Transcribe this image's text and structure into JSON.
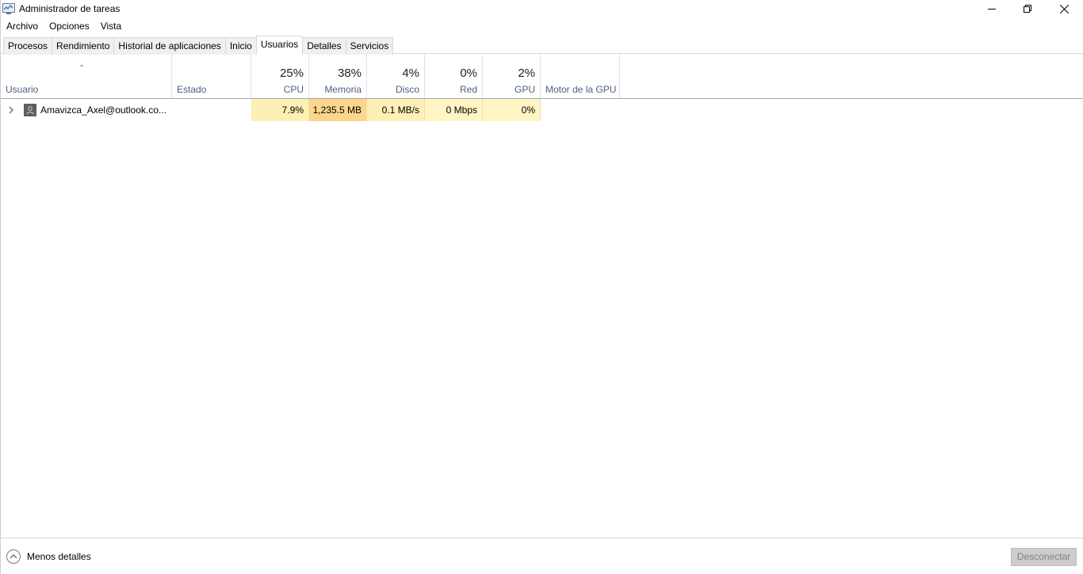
{
  "window": {
    "title": "Administrador de tareas",
    "icons": {
      "app": "task-manager-icon",
      "minimize": "minimize-icon",
      "restore": "restore-icon",
      "close": "close-icon"
    }
  },
  "menu": [
    "Archivo",
    "Opciones",
    "Vista"
  ],
  "tabs": [
    "Procesos",
    "Rendimiento",
    "Historial de aplicaciones",
    "Inicio",
    "Usuarios",
    "Detalles",
    "Servicios"
  ],
  "active_tab": "Usuarios",
  "columns": {
    "user": {
      "label": "Usuario",
      "sort": "ascending"
    },
    "state": {
      "label": "Estado"
    },
    "cpu": {
      "percent": "25%",
      "label": "CPU"
    },
    "memory": {
      "percent": "38%",
      "label": "Memoria"
    },
    "disk": {
      "percent": "4%",
      "label": "Disco"
    },
    "network": {
      "percent": "0%",
      "label": "Red"
    },
    "gpu": {
      "percent": "2%",
      "label": "GPU"
    },
    "gpu_engine": {
      "label": "Motor de la GPU"
    }
  },
  "rows": [
    {
      "user": "Amavizca_Axel@outlook.co...",
      "state": "",
      "cpu": "7.9%",
      "memory": "1,235.5 MB",
      "disk": "0.1 MB/s",
      "network": "0 Mbps",
      "gpu": "0%",
      "gpu_engine": ""
    }
  ],
  "heat_colors": {
    "cpu": "#fdf0b6",
    "memory": "#fbd68c",
    "disk": "#fdf0b6",
    "network": "#fff4c4",
    "gpu": "#fff4c4"
  },
  "footer": {
    "less_details": "Menos detalles",
    "disconnect": "Desconectar"
  }
}
